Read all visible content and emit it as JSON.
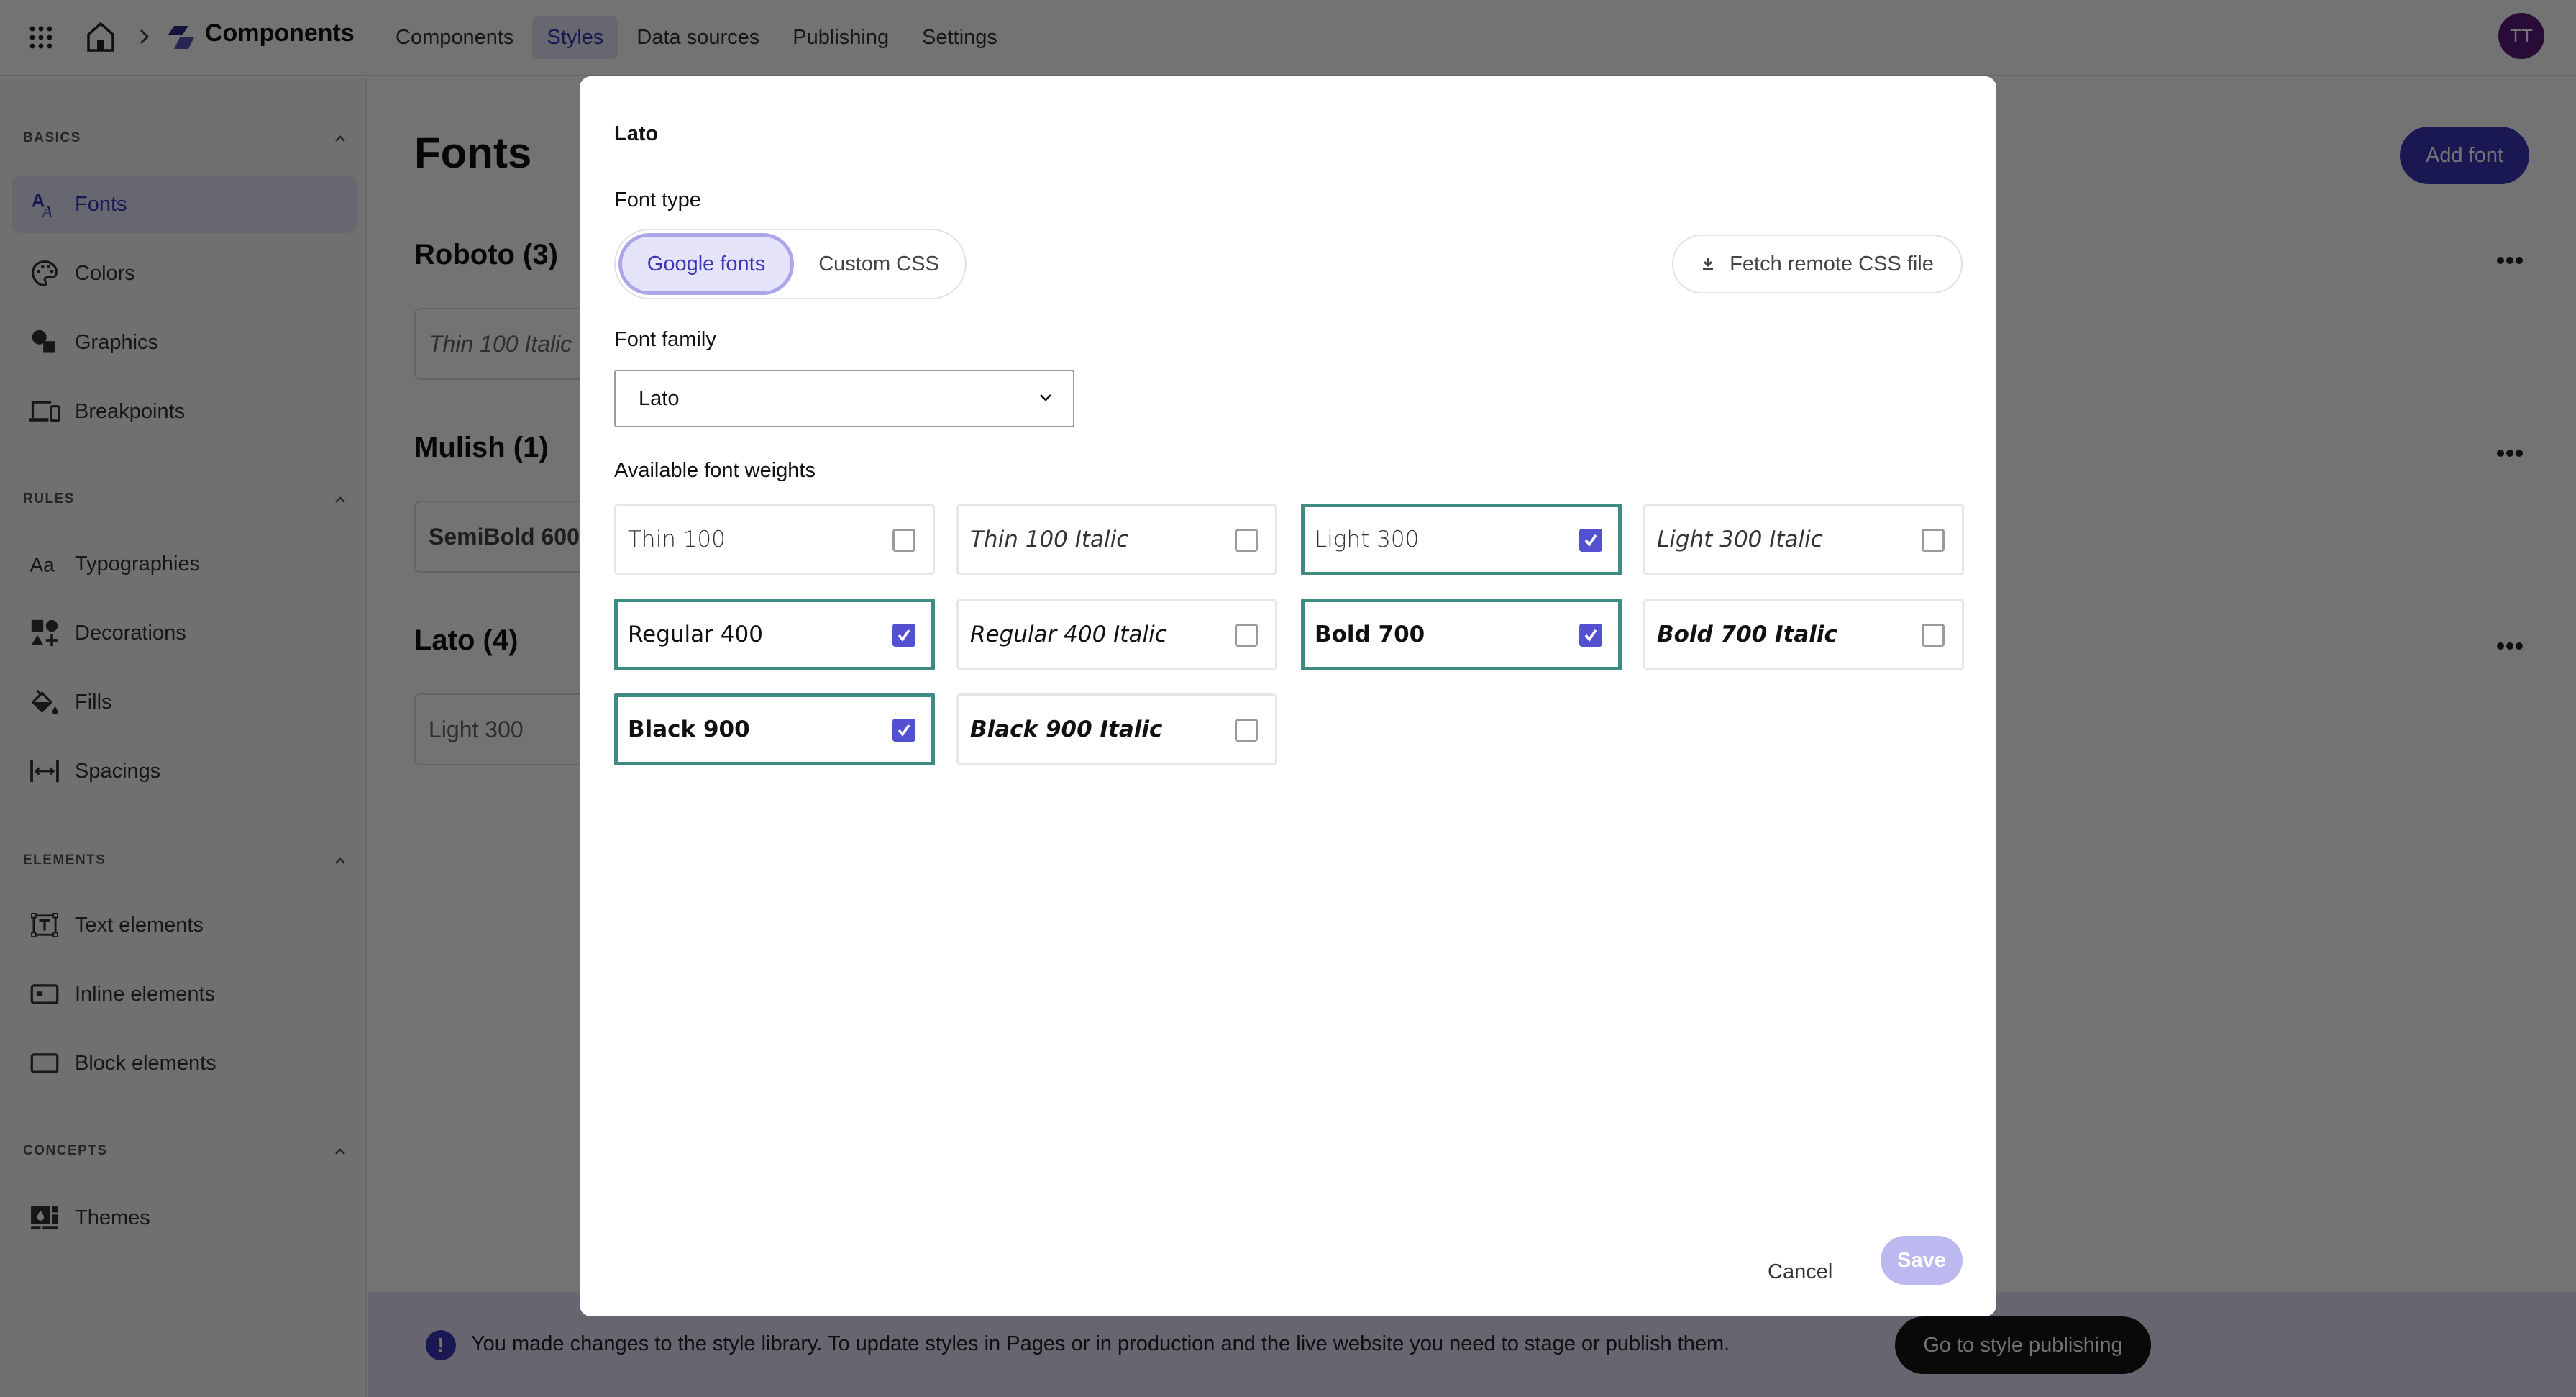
{
  "topbar": {
    "app_title": "Components",
    "nav": [
      {
        "label": "Components",
        "active": false
      },
      {
        "label": "Styles",
        "active": true
      },
      {
        "label": "Data sources",
        "active": false
      },
      {
        "label": "Publishing",
        "active": false
      },
      {
        "label": "Settings",
        "active": false
      }
    ],
    "avatar_initials": "TT",
    "icons": {
      "apps": "grid-dots-icon",
      "home": "home-icon",
      "separator": "chevron-right-icon",
      "logo": "components-logo-icon"
    }
  },
  "sidebar": {
    "sections": [
      {
        "title": "BASICS",
        "items": [
          {
            "label": "Fonts",
            "icon": "fonts-icon",
            "active": true
          },
          {
            "label": "Colors",
            "icon": "palette-icon",
            "active": false
          },
          {
            "label": "Graphics",
            "icon": "graphics-icon",
            "active": false
          },
          {
            "label": "Breakpoints",
            "icon": "devices-icon",
            "active": false
          }
        ]
      },
      {
        "title": "RULES",
        "items": [
          {
            "label": "Typographies",
            "icon": "typography-icon",
            "active": false
          },
          {
            "label": "Decorations",
            "icon": "shapes-icon",
            "active": false
          },
          {
            "label": "Fills",
            "icon": "paint-bucket-icon",
            "active": false
          },
          {
            "label": "Spacings",
            "icon": "spacing-icon",
            "active": false
          }
        ]
      },
      {
        "title": "ELEMENTS",
        "items": [
          {
            "label": "Text elements",
            "icon": "text-element-icon",
            "active": false
          },
          {
            "label": "Inline elements",
            "icon": "inline-element-icon",
            "active": false
          },
          {
            "label": "Block elements",
            "icon": "block-element-icon",
            "active": false
          }
        ]
      },
      {
        "title": "CONCEPTS",
        "items": [
          {
            "label": "Themes",
            "icon": "themes-icon",
            "active": false
          }
        ]
      }
    ]
  },
  "main": {
    "page_title": "Fonts",
    "add_font_label": "Add font",
    "families": [
      {
        "title": "Roboto (3)",
        "first_weight": "Thin 100 Italic"
      },
      {
        "title": "Mulish (1)",
        "first_weight": "SemiBold 600"
      },
      {
        "title": "Lato (4)",
        "first_weight": "Light 300"
      }
    ]
  },
  "banner": {
    "message": "You made changes to the style library. To update styles in Pages or in production and the live website you need to stage or publish them.",
    "button_label": "Go to style publishing",
    "icon": "!"
  },
  "modal": {
    "title": "Lato",
    "font_type_label": "Font type",
    "font_type_options": [
      {
        "label": "Google fonts",
        "selected": true
      },
      {
        "label": "Custom CSS",
        "selected": false
      }
    ],
    "fetch_label": "Fetch remote CSS file",
    "font_family_label": "Font family",
    "font_family_value": "Lato",
    "weights_label": "Available font weights",
    "weights": [
      {
        "label": "Thin 100",
        "weight": 100,
        "italic": false,
        "checked": false
      },
      {
        "label": "Thin 100 Italic",
        "weight": 100,
        "italic": true,
        "checked": false
      },
      {
        "label": "Light 300",
        "weight": 300,
        "italic": false,
        "checked": true
      },
      {
        "label": "Light 300 Italic",
        "weight": 300,
        "italic": true,
        "checked": false
      },
      {
        "label": "Regular 400",
        "weight": 400,
        "italic": false,
        "checked": true
      },
      {
        "label": "Regular 400 Italic",
        "weight": 400,
        "italic": true,
        "checked": false
      },
      {
        "label": "Bold 700",
        "weight": 700,
        "italic": false,
        "checked": true
      },
      {
        "label": "Bold 700 Italic",
        "weight": 700,
        "italic": true,
        "checked": false
      },
      {
        "label": "Black 900",
        "weight": 900,
        "italic": false,
        "checked": true
      },
      {
        "label": "Black 900 Italic",
        "weight": 900,
        "italic": true,
        "checked": false
      }
    ],
    "cancel_label": "Cancel",
    "save_label": "Save"
  },
  "colors": {
    "accent": "#3a36b8",
    "checkbox_checked": "#5450d2",
    "selected_border": "#3f8a82",
    "save_disabled": "#bcb9f0",
    "avatar": "#5a1a7a"
  }
}
